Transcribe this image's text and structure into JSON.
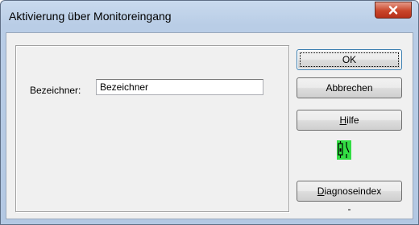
{
  "window": {
    "title": "Aktivierung über Monitoreingang"
  },
  "form": {
    "identifier_label": "Bezeichner:",
    "identifier_value": "Bezeichner"
  },
  "buttons": {
    "ok": "OK",
    "cancel": "Abbrechen",
    "help_mnemonic": "H",
    "help_rest": "ilfe",
    "diag_mnemonic": "D",
    "diag_rest": "iagnoseindex"
  },
  "diagnostics": {
    "value": "-"
  },
  "icons": {
    "close": "close-icon",
    "status": "switch-status-icon"
  },
  "colors": {
    "status_icon_bg": "#33dd44",
    "close_button": "#c9452a"
  }
}
